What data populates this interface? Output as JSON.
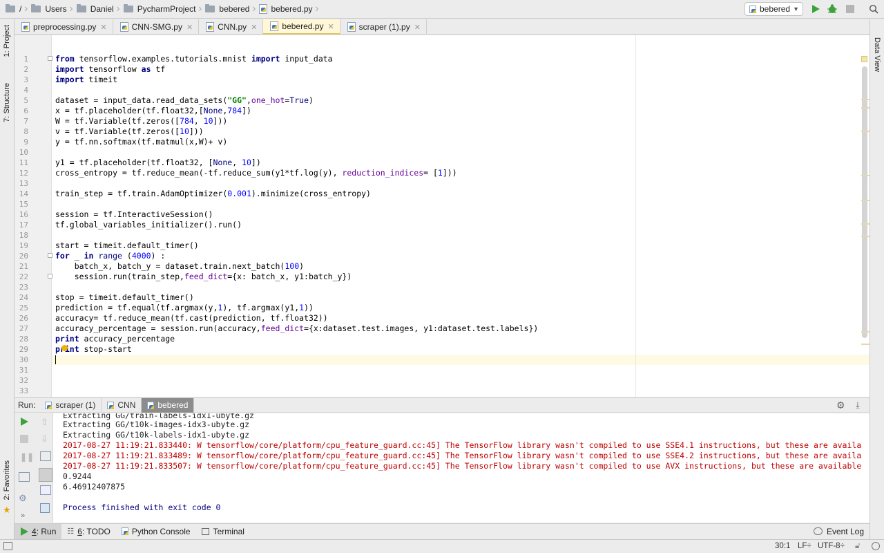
{
  "breadcrumb": [
    "/",
    "Users",
    "Daniel",
    "PycharmProject",
    "bebered",
    "bebered.py"
  ],
  "toolbar": {
    "run_config": "bebered"
  },
  "left_tools": {
    "project": "1: Project",
    "structure": "7: Structure",
    "favorites": "2: Favorites"
  },
  "right_tools": {
    "data_view": "Data View"
  },
  "tabs": [
    {
      "label": "preprocessing.py",
      "active": false
    },
    {
      "label": "CNN-SMG.py",
      "active": false
    },
    {
      "label": "CNN.py",
      "active": false
    },
    {
      "label": "bebered.py",
      "active": true
    },
    {
      "label": "scraper (1).py",
      "active": false
    }
  ],
  "editor": {
    "line_numbers": [
      "1",
      "2",
      "3",
      "4",
      "5",
      "6",
      "7",
      "8",
      "9",
      "10",
      "11",
      "12",
      "13",
      "14",
      "15",
      "16",
      "17",
      "18",
      "19",
      "20",
      "21",
      "22",
      "23",
      "24",
      "25",
      "26",
      "27",
      "28",
      "29",
      "30",
      "31",
      "32",
      "33"
    ]
  },
  "run_panel": {
    "label": "Run:",
    "tabs": [
      {
        "label": "scraper (1)",
        "active": false
      },
      {
        "label": "CNN",
        "active": false
      },
      {
        "label": "bebered",
        "active": true
      }
    ],
    "output": [
      "Extracting GG/train-labels-idx1-ubyte.gz",
      "Extracting GG/t10k-images-idx3-ubyte.gz",
      "Extracting GG/t10k-labels-idx1-ubyte.gz",
      "2017-08-27 11:19:21.833440: W tensorflow/core/platform/cpu_feature_guard.cc:45] The TensorFlow library wasn't compiled to use SSE4.1 instructions, but these are availa",
      "2017-08-27 11:19:21.833489: W tensorflow/core/platform/cpu_feature_guard.cc:45] The TensorFlow library wasn't compiled to use SSE4.2 instructions, but these are availa",
      "2017-08-27 11:19:21.833507: W tensorflow/core/platform/cpu_feature_guard.cc:45] The TensorFlow library wasn't compiled to use AVX instructions, but these are available",
      "0.9244",
      "6.46912407875",
      "",
      "Process finished with exit code 0"
    ]
  },
  "bottom_bar": {
    "run_num": "4",
    "run": ": Run",
    "todo_num": "6",
    "todo": ": TODO",
    "python_console": "Python Console",
    "terminal": "Terminal",
    "event_log": "Event Log"
  },
  "status": {
    "position": "30:1",
    "line_sep": "LF÷",
    "encoding": "UTF-8÷"
  },
  "colors": {
    "keyword": "#000080",
    "number": "#0000ff",
    "string": "#008000",
    "param": "#660099",
    "error": "#c00000"
  }
}
